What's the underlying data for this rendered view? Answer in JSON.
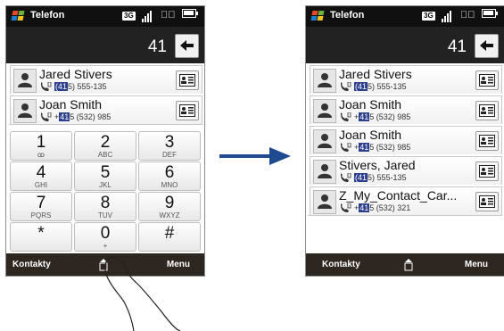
{
  "left_screen": {
    "statusbar": {
      "title": "Telefon",
      "network": "3G"
    },
    "dial_number": "41",
    "contacts": [
      {
        "name": "Jared Stivers",
        "number_prefix": "",
        "number_highlight": "(41",
        "number_rest": "5) 555-135"
      },
      {
        "name": "Joan Smith",
        "number_prefix": "+",
        "number_highlight": "41",
        "number_rest": "5 (532) 985"
      }
    ],
    "keypad": [
      {
        "digit": "1",
        "sub": "ꝏ"
      },
      {
        "digit": "2",
        "sub": "ABC"
      },
      {
        "digit": "3",
        "sub": "DEF"
      },
      {
        "digit": "4",
        "sub": "GHI"
      },
      {
        "digit": "5",
        "sub": "JKL"
      },
      {
        "digit": "6",
        "sub": "MNO"
      },
      {
        "digit": "7",
        "sub": "PQRS"
      },
      {
        "digit": "8",
        "sub": "TUV"
      },
      {
        "digit": "9",
        "sub": "WXYZ"
      },
      {
        "digit": "*",
        "sub": ""
      },
      {
        "digit": "0",
        "sub": "+"
      },
      {
        "digit": "#",
        "sub": ""
      }
    ],
    "softkeys": {
      "left": "Kontakty",
      "right": "Menu"
    }
  },
  "right_screen": {
    "statusbar": {
      "title": "Telefon",
      "network": "3G"
    },
    "dial_number": "41",
    "contacts": [
      {
        "name": "Jared Stivers",
        "number_prefix": "",
        "number_highlight": "(41",
        "number_rest": "5) 555-135"
      },
      {
        "name": "Joan Smith",
        "number_prefix": "+",
        "number_highlight": "41",
        "number_rest": "5 (532) 985"
      },
      {
        "name": "Joan Smith",
        "number_prefix": "+",
        "number_highlight": "41",
        "number_rest": "5 (532) 985"
      },
      {
        "name": "Stivers, Jared",
        "number_prefix": "",
        "number_highlight": "(41",
        "number_rest": "5) 555-135"
      },
      {
        "name": "Z_My_Contact_Car...",
        "number_prefix": "+",
        "number_highlight": "41",
        "number_rest": "5 (532) 321"
      }
    ],
    "softkeys": {
      "left": "Kontakty",
      "right": "Menu"
    }
  },
  "colors": {
    "highlight": "#2c3f8d",
    "arrow": "#1f4a8f",
    "statusbar": "#101010",
    "softbar": "#2e2620"
  },
  "icons": [
    "windows-logo-icon",
    "signal-icon",
    "speaker-icon",
    "battery-icon",
    "backspace-icon",
    "contact-avatar-icon",
    "phone-icon",
    "contact-card-icon",
    "keyboard-toggle-icon",
    "pointing-hand-icon",
    "transition-arrow-icon"
  ]
}
